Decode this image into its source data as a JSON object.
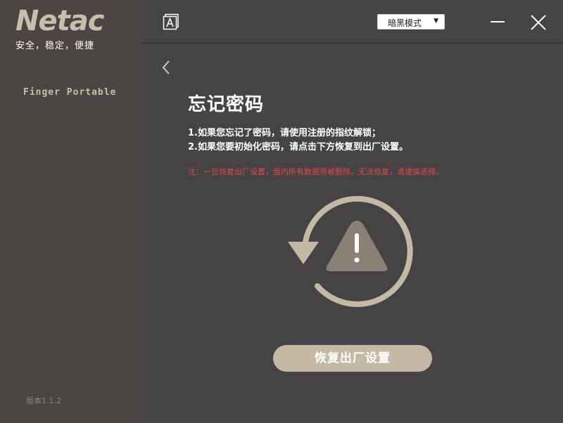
{
  "sidebar": {
    "logo": "Netac",
    "slogan": "安全，稳定，便捷",
    "items": [
      {
        "label": "Finger Portable"
      }
    ],
    "version": "版本1.1.2"
  },
  "topbar": {
    "font_icon": "font-size-icon",
    "theme_select": {
      "selected": "暗黑模式"
    },
    "minimize_icon": "minimize-icon",
    "close_icon": "close-icon"
  },
  "content": {
    "back_icon": "chevron-left-icon",
    "title": "忘记密码",
    "lines": [
      "1.如果您忘记了密码，请使用注册的指纹解锁；",
      "2.如果您要初始化密码，请点击下方恢复到出厂设置。"
    ],
    "note": "注：一旦恢复出厂设置，盘内所有数据将被删除，无法恢复，请谨慎选择。",
    "hero_icon": "reset-warning-icon",
    "reset_button": "恢复出厂设置"
  },
  "colors": {
    "accent": "#c4b9a4",
    "warning_text": "#e0474c",
    "sidebar_bg": "#4a4644",
    "main_bg": "#454343"
  }
}
